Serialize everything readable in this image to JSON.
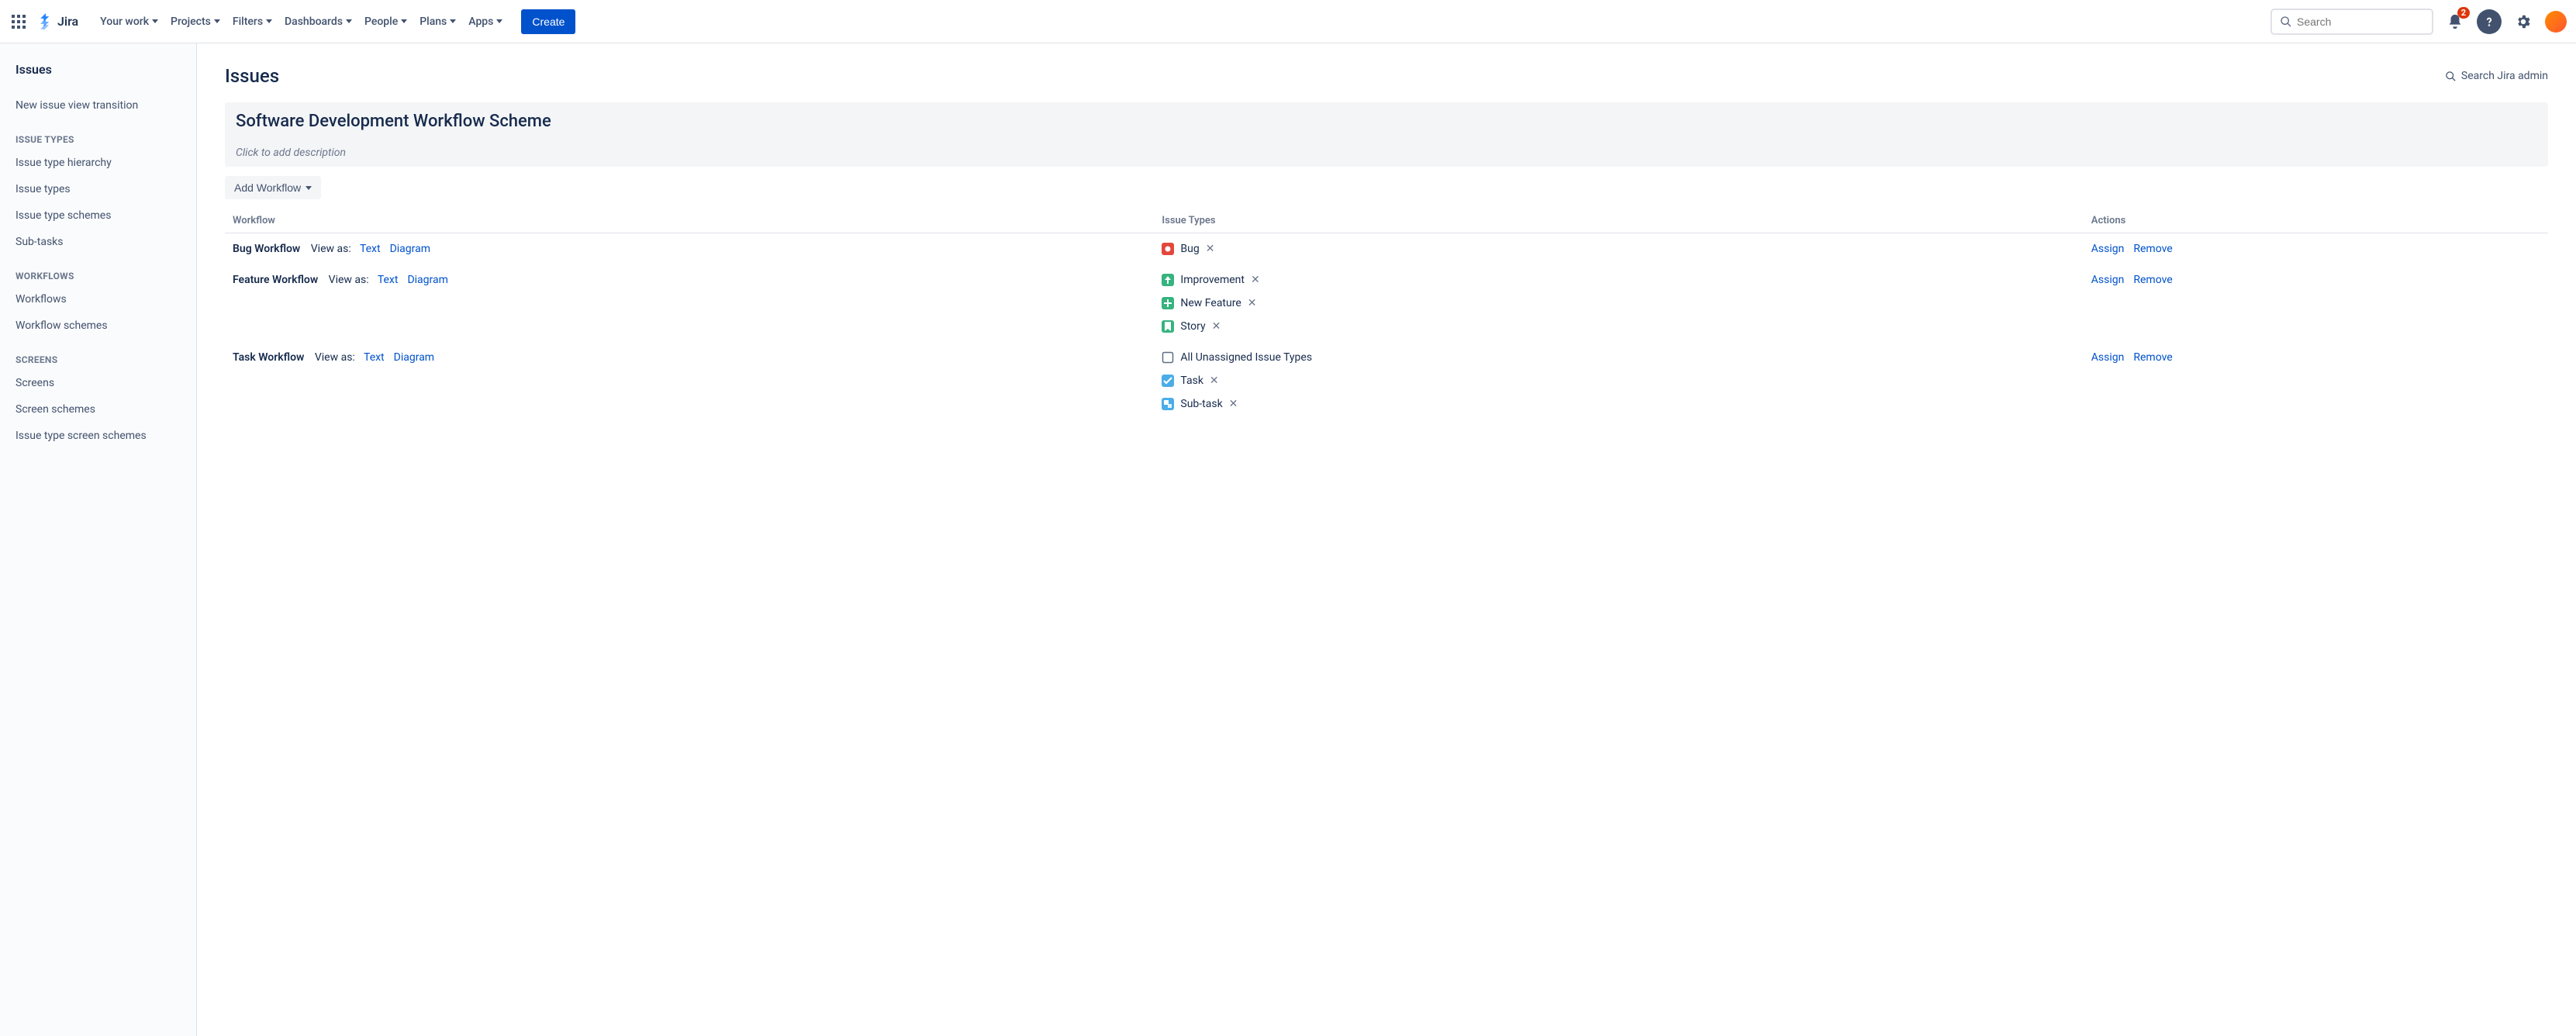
{
  "nav": {
    "product": "Jira",
    "items": [
      "Your work",
      "Projects",
      "Filters",
      "Dashboards",
      "People",
      "Plans",
      "Apps"
    ],
    "create": "Create",
    "search_placeholder": "Search",
    "notif_count": "2"
  },
  "sidebar": {
    "title": "Issues",
    "top_links": [
      "New issue view transition"
    ],
    "groups": [
      {
        "label": "ISSUE TYPES",
        "items": [
          "Issue type hierarchy",
          "Issue types",
          "Issue type schemes",
          "Sub-tasks"
        ]
      },
      {
        "label": "WORKFLOWS",
        "items": [
          "Workflows",
          "Workflow schemes"
        ]
      },
      {
        "label": "SCREENS",
        "items": [
          "Screens",
          "Screen schemes",
          "Issue type screen schemes"
        ]
      }
    ]
  },
  "page": {
    "title": "Issues",
    "admin_search": "Search Jira admin",
    "scheme_title": "Software Development Workflow Scheme",
    "scheme_desc_placeholder": "Click to add description",
    "add_workflow": "Add Workflow",
    "columns": {
      "workflow": "Workflow",
      "issue_types": "Issue Types",
      "actions": "Actions"
    },
    "view_as_label": "View as:",
    "view_text": "Text",
    "view_diagram": "Diagram",
    "action_assign": "Assign",
    "action_remove": "Remove",
    "rows": [
      {
        "name": "Bug Workflow",
        "issue_types": [
          {
            "name": "Bug",
            "icon": "bug",
            "removable": true
          }
        ]
      },
      {
        "name": "Feature Workflow",
        "issue_types": [
          {
            "name": "Improvement",
            "icon": "improvement",
            "removable": true
          },
          {
            "name": "New Feature",
            "icon": "newfeature",
            "removable": true
          },
          {
            "name": "Story",
            "icon": "story",
            "removable": true
          }
        ]
      },
      {
        "name": "Task Workflow",
        "issue_types": [
          {
            "name": "All Unassigned Issue Types",
            "icon": "unassigned",
            "removable": false
          },
          {
            "name": "Task",
            "icon": "task",
            "removable": true
          },
          {
            "name": "Sub-task",
            "icon": "subtask",
            "removable": true
          }
        ]
      }
    ]
  },
  "icons": {
    "bug": {
      "bg": "#E2483D",
      "glyph": "circle"
    },
    "improvement": {
      "bg": "#36B37E",
      "glyph": "arrow-up"
    },
    "newfeature": {
      "bg": "#36B37E",
      "glyph": "plus"
    },
    "story": {
      "bg": "#36B37E",
      "glyph": "bookmark"
    },
    "unassigned": {
      "bg": "#FFFFFF",
      "glyph": "blank-outline"
    },
    "task": {
      "bg": "#4BADE8",
      "glyph": "check"
    },
    "subtask": {
      "bg": "#4BADE8",
      "glyph": "branch"
    }
  }
}
